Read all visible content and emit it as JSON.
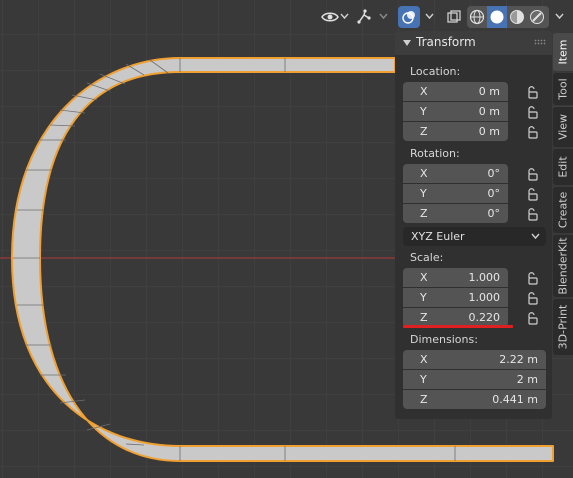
{
  "header": {
    "icons": [
      "visibility-eye-icon",
      "gizmo-icon",
      "overlay-icon",
      "xray-icon",
      "wireframe-shading-icon",
      "solid-shading-icon",
      "material-shading-icon",
      "rendered-shading-icon"
    ]
  },
  "panel": {
    "title": "Transform",
    "location_label": "Location:",
    "location": [
      {
        "axis": "X",
        "value": "0 m"
      },
      {
        "axis": "Y",
        "value": "0 m"
      },
      {
        "axis": "Z",
        "value": "0 m"
      }
    ],
    "rotation_label": "Rotation:",
    "rotation": [
      {
        "axis": "X",
        "value": "0°"
      },
      {
        "axis": "Y",
        "value": "0°"
      },
      {
        "axis": "Z",
        "value": "0°"
      }
    ],
    "rotation_mode": "XYZ Euler",
    "scale_label": "Scale:",
    "scale": [
      {
        "axis": "X",
        "value": "1.000"
      },
      {
        "axis": "Y",
        "value": "1.000"
      },
      {
        "axis": "Z",
        "value": "0.220"
      }
    ],
    "dimensions_label": "Dimensions:",
    "dimensions": [
      {
        "axis": "X",
        "value": "2.22 m"
      },
      {
        "axis": "Y",
        "value": "2 m"
      },
      {
        "axis": "Z",
        "value": "0.441 m"
      }
    ]
  },
  "tabs": [
    "Item",
    "Tool",
    "View",
    "Edit",
    "Create",
    "BlenderKit",
    "3D-Print"
  ],
  "active_tab": "Item",
  "colors": {
    "background": "#393939",
    "mesh_face": "#c9c9c9",
    "selection_outline": "#f0a030",
    "x_axis_line": "#b03a3a",
    "highlight_underline": "#e02020",
    "active_shading": "#4772b3"
  }
}
